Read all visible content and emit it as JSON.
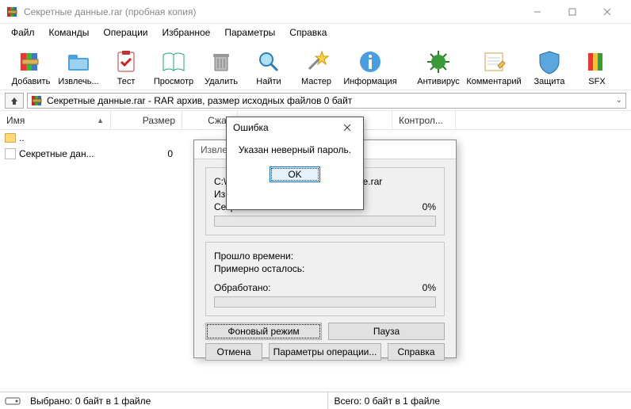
{
  "window": {
    "title": "Секретные данные.rar (пробная копия)"
  },
  "menu": {
    "file": "Файл",
    "commands": "Команды",
    "operations": "Операции",
    "favorites": "Избранное",
    "options": "Параметры",
    "help": "Справка"
  },
  "toolbar": {
    "add": "Добавить",
    "extract": "Извлечь...",
    "test": "Тест",
    "view": "Просмотр",
    "delete": "Удалить",
    "find": "Найти",
    "wizard": "Мастер",
    "info": "Информация",
    "antivirus": "Антивирус",
    "comment": "Комментарий",
    "protect": "Защита",
    "sfx": "SFX"
  },
  "pathbar": {
    "text": "Секретные данные.rar - RAR архив, размер исходных файлов 0 байт"
  },
  "columns": {
    "name": "Имя",
    "size": "Размер",
    "packed": "Сжат",
    "crc": "Контрол..."
  },
  "rows": {
    "up": "..",
    "file1_name": "Секретные дан...",
    "file1_size": "0"
  },
  "status": {
    "left": "Выбрано: 0 байт в 1 файле",
    "right": "Всего: 0 байт в 1 файле"
  },
  "extract": {
    "title": "Извле",
    "path_prefix": "C:\\U",
    "path_suffix": "е данные.rar",
    "line2": "Извл",
    "line3_label": "Секр",
    "line3_pct": "0%",
    "elapsed": "Прошло времени:",
    "remaining": "Примерно осталось:",
    "processed": "Обработано:",
    "processed_pct": "0%",
    "btn_background": "Фоновый режим",
    "btn_pause": "Пауза",
    "btn_cancel": "Отмена",
    "btn_params": "Параметры операции...",
    "btn_help": "Справка"
  },
  "error": {
    "title": "Ошибка",
    "message": "Указан неверный пароль.",
    "ok": "OK"
  }
}
